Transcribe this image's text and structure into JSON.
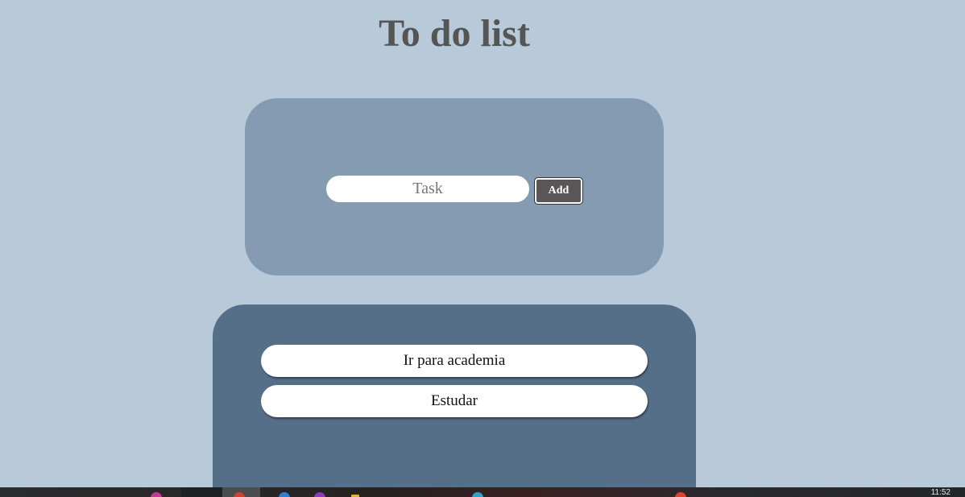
{
  "page": {
    "title": "To do list"
  },
  "form": {
    "task_placeholder": "Task",
    "task_value": "",
    "add_label": "Add"
  },
  "tasks": [
    {
      "label": "Ir para academia"
    },
    {
      "label": "Estudar"
    }
  ],
  "taskbar": {
    "clock": "11:52",
    "icons": [
      "app-icon-pink",
      "chrome-icon",
      "edge-icon",
      "purple-app-icon",
      "folder-icon",
      "teams-icon",
      "app-icon-red"
    ]
  },
  "colors": {
    "background": "#b8c9da",
    "input_card": "#849bb1",
    "list_card": "#566f88",
    "title": "#555555",
    "add_button": "#5a5658"
  }
}
